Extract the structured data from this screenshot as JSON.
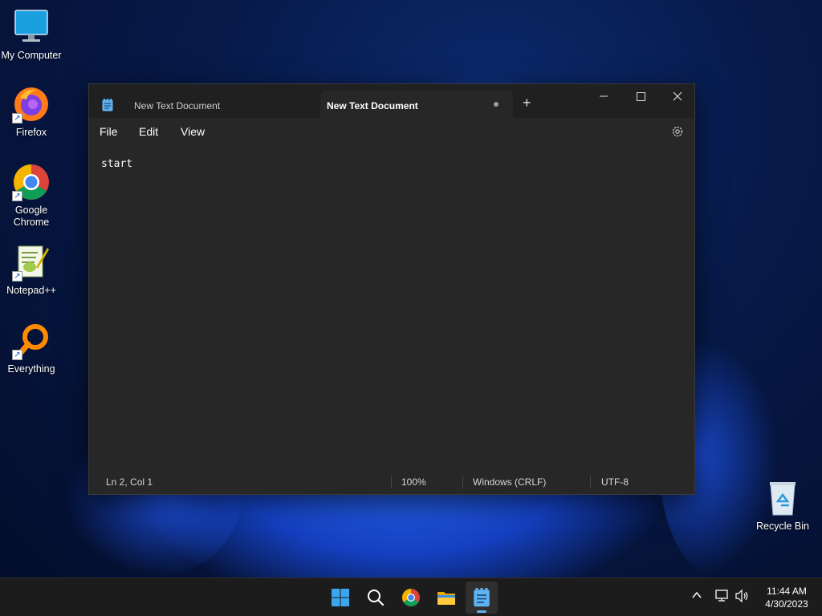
{
  "desktop": {
    "icons": [
      {
        "label": "My Computer",
        "icon": "monitor-icon"
      },
      {
        "label": "Firefox",
        "icon": "firefox-icon"
      },
      {
        "label": "Google Chrome",
        "icon": "chrome-icon"
      },
      {
        "label": "Notepad++",
        "icon": "notepad-plus-plus-icon"
      },
      {
        "label": "Everything",
        "icon": "search-magnifier-icon"
      },
      {
        "label": "Recycle Bin",
        "icon": "recycle-bin-icon"
      }
    ]
  },
  "window": {
    "tabs": [
      {
        "label": "New Text Document",
        "active": false
      },
      {
        "label": "New Text Document",
        "active": true,
        "unsaved": true
      }
    ],
    "controls": {
      "minimize": "minimize-icon",
      "maximize": "maximize-icon",
      "close": "close-icon"
    },
    "menu": {
      "file": "File",
      "edit": "Edit",
      "view": "View"
    },
    "content": "start",
    "status": {
      "position": "Ln 2, Col 1",
      "zoom": "100%",
      "line_ending": "Windows (CRLF)",
      "encoding": "UTF-8"
    }
  },
  "taskbar": {
    "apps": [
      "windows-start-icon",
      "search-icon",
      "chrome-icon",
      "file-explorer-icon",
      "notepad-icon"
    ],
    "tray": {
      "chevron": "chevron-up-icon",
      "network": "network-icon",
      "volume": "volume-icon"
    },
    "clock": {
      "time": "11:44 AM",
      "date": "4/30/2023"
    }
  },
  "colors": {
    "accent": "#5fb2f2",
    "window_bg": "#272727",
    "titlebar_bg": "#202020",
    "taskbar_bg": "#1c1c1c"
  }
}
